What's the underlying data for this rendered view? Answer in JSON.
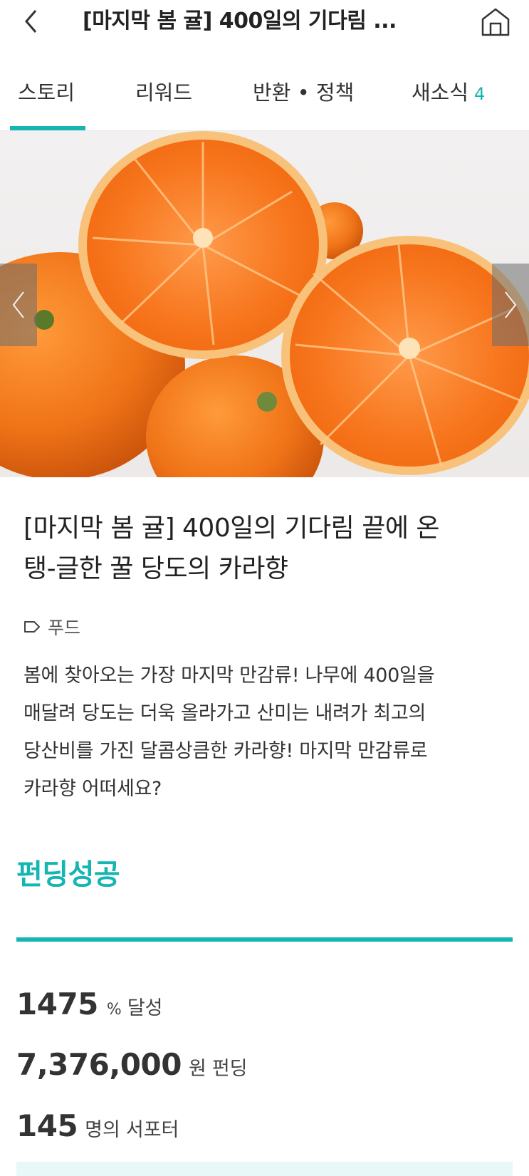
{
  "header": {
    "title": "[마지막 봄 귤] 400일의 기다림 ...",
    "back_icon": "chevron-left-icon",
    "home_icon": "home-icon"
  },
  "tabs": [
    {
      "label": "스토리",
      "active": true
    },
    {
      "label": "리워드",
      "active": false
    },
    {
      "label": "반환 • 정책",
      "active": false
    },
    {
      "label": "새소식",
      "count": "4",
      "active": false
    }
  ],
  "hero": {
    "prev_icon": "chevron-left-icon",
    "next_icon": "chevron-right-icon"
  },
  "project": {
    "title_line1": "[마지막 봄 귤] 400일의 기다림 끝에 온",
    "title_line2": "탱-글한 꿀 당도의 카라향",
    "category": "푸드",
    "category_icon": "tag-icon",
    "description_lines": [
      "봄에 찾아오는 가장 마지막 만감류! 나무에 400일을",
      "매달려 당도는 더욱 올라가고 산미는 내려가 최고의",
      "당산비를 가진 달콤상큼한 카라향! 마지막 만감류로",
      "카라향 어떠세요?"
    ]
  },
  "funding": {
    "status": "펀딩성공",
    "progress_fraction": 1.0,
    "percent_value": "1475",
    "percent_unit": "%",
    "percent_suffix": "달성",
    "amount_value": "7,376,000",
    "amount_unit": "원",
    "amount_suffix": "펀딩",
    "supporters_value": "145",
    "supporters_unit": "명의",
    "supporters_suffix": "서포터"
  },
  "colors": {
    "accent": "#14b5b2",
    "text": "#222222",
    "orange": "#f47a1f"
  }
}
